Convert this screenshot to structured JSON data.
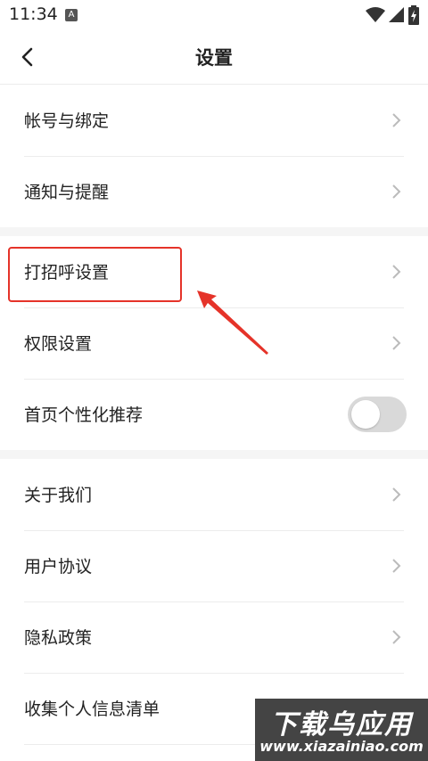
{
  "status_bar": {
    "time": "11:34",
    "notification_icon": "A",
    "icons": [
      "wifi-icon",
      "signal-icon",
      "battery-icon"
    ]
  },
  "header": {
    "title": "设置",
    "back_icon": "chevron-left-icon"
  },
  "groups": [
    {
      "items": [
        {
          "label": "帐号与绑定",
          "type": "link"
        },
        {
          "label": "通知与提醒",
          "type": "link"
        }
      ]
    },
    {
      "items": [
        {
          "label": "打招呼设置",
          "type": "link",
          "highlighted": true
        },
        {
          "label": "权限设置",
          "type": "link"
        },
        {
          "label": "首页个性化推荐",
          "type": "toggle",
          "on": false
        }
      ]
    },
    {
      "items": [
        {
          "label": "关于我们",
          "type": "link"
        },
        {
          "label": "用户协议",
          "type": "link"
        },
        {
          "label": "隐私政策",
          "type": "link"
        },
        {
          "label": "收集个人信息清单",
          "type": "link"
        }
      ]
    }
  ],
  "annotation": {
    "color": "#e53329"
  },
  "watermark": {
    "title": "下载乌应用",
    "url": "www.xiazainiao.com"
  },
  "colors": {
    "background": "#f5f5f5",
    "card": "#ffffff",
    "text": "#222222",
    "chevron": "#bbbbbb",
    "toggle_off": "#d9d9d9"
  }
}
